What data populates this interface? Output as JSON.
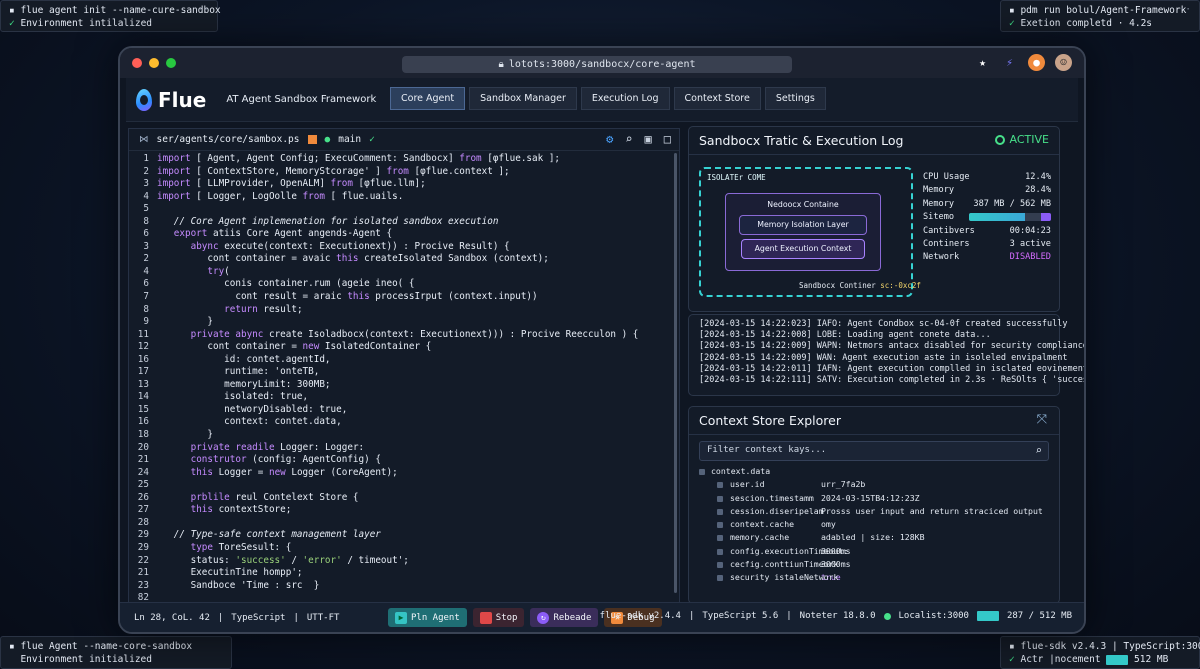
{
  "terminals": {
    "top_left": {
      "line1": "flue agent init --name-cure-sandbox",
      "line2": "Environment intilalized"
    },
    "top_right": {
      "line1": "pdm run bolul/Agent-Framework",
      "line2": "Exetion completd · 4.2s"
    },
    "bottom_left": {
      "line1": "flue Agent  --name-core-sandbox",
      "line2": "Environment initialized"
    },
    "bottom_right": {
      "line1": "flue-sdk v2.4.3 | TypeScript:3000",
      "line2": "Actr |nocement",
      "mem": "512 MB"
    }
  },
  "browser": {
    "url": "lotots:3000/sandbocx/core-agent"
  },
  "app": {
    "name": "Flue",
    "subtitle": "AT Agent Sandbox Framework",
    "tabs": [
      "Core Agent",
      "Sandbox Manager",
      "Execution Log",
      "Context Store",
      "Settings"
    ],
    "active_tab": "Core Agent"
  },
  "editor": {
    "path": "ser/agents/core/sambox.ps",
    "branch": "main",
    "lines": [
      {
        "n": "1",
        "t": "import [ Agent, Agent Config; ExecuComment: Sandbocx] from [φflue.sak ];"
      },
      {
        "n": "2",
        "t": "import [ ContextStore, MemoryStcorage' ] from [φflue.context ];"
      },
      {
        "n": "3",
        "t": "import [ LLMProvider, OpenALM] from [φflue.llm];"
      },
      {
        "n": "4",
        "t": "import [ Logger, LogOolle from [ flue.uails."
      },
      {
        "n": "5",
        "t": ""
      },
      {
        "n": "8",
        "t": "   // Core Agent inplemenation for isolated sandbox execution"
      },
      {
        "n": "6",
        "t": "   export atiis Core Agent angends-Agent {"
      },
      {
        "n": "3",
        "t": "      abync execute(context: Executionext)) : Procive Result) {"
      },
      {
        "n": "2",
        "t": "         cont container = avaic this createIsolated Sandbox (context);"
      },
      {
        "n": "4",
        "t": "         try("
      },
      {
        "n": "6",
        "t": "            conis container.rum (ageie ineo( {"
      },
      {
        "n": "7",
        "t": "              cont result = araic this processIrput (context.input))"
      },
      {
        "n": "8",
        "t": "            return result;"
      },
      {
        "n": "9",
        "t": "         }"
      },
      {
        "n": "11",
        "t": "      private abync create Isoladbocx(context: Executionext))) : Procive Reecculon ) {"
      },
      {
        "n": "12",
        "t": "         cont container = new IsolatedContainer {"
      },
      {
        "n": "16",
        "t": "            id: contet.agentId,"
      },
      {
        "n": "17",
        "t": "            runtime: 'onteTB,"
      },
      {
        "n": "13",
        "t": "            memoryLimit: 300MB;"
      },
      {
        "n": "14",
        "t": "            isolated: true,"
      },
      {
        "n": "15",
        "t": "            networyDisabled: true,"
      },
      {
        "n": "16",
        "t": "            context: contet.data,"
      },
      {
        "n": "18",
        "t": "         }"
      },
      {
        "n": "20",
        "t": "      private readile Logger: Logger:"
      },
      {
        "n": "21",
        "t": "      construtor (config: AgentConfig) {"
      },
      {
        "n": "24",
        "t": "      this Logger = new Logger (CoreAgent);"
      },
      {
        "n": "25",
        "t": ""
      },
      {
        "n": "26",
        "t": "      prblile reul Contelext Store {"
      },
      {
        "n": "27",
        "t": "      this contextStore;"
      },
      {
        "n": "28",
        "t": ""
      },
      {
        "n": "29",
        "t": "   // Type-safe context management layer"
      },
      {
        "n": "29",
        "t": "      type ToreSesult: {"
      },
      {
        "n": "22",
        "t": "      status: 'success' / 'error' / timeout';"
      },
      {
        "n": "21",
        "t": "      ExecutinTine hompp';"
      },
      {
        "n": "23",
        "t": "      Sandboce 'Time : src  }"
      },
      {
        "n": "82",
        "t": ""
      }
    ]
  },
  "sandbox": {
    "title": "Sandbocx Tratic & Execution Log",
    "status": "ACTIVE",
    "iso_label": "ISOLATEr COME",
    "node_container": "Nedoocx Containe",
    "node_memory": "Memory Isolation Layer",
    "node_context": "Agent Execution Context",
    "container_label": "Sandbocx Continer",
    "container_id": "sc:-0xc2f",
    "stats": {
      "cpu_label": "CPU Usage",
      "cpu_value": "12.4%",
      "mem_label": "Memory",
      "mem_pct": "28.4%",
      "mem2_label": "Memory",
      "mem2_value": "387 MB / 562 MB",
      "sitemo_label": "Sitemo",
      "sitemo_fill": 0.68,
      "cant_label": "Cantibvers",
      "cant_value": "00:04:23",
      "cont_label": "Continers",
      "cont_value": "3 active",
      "net_label": "Network",
      "net_value": "DISABLED"
    },
    "colors": {
      "active": "#47e08a",
      "disabled": "#d56cff",
      "iso_border": "#36d3d3"
    }
  },
  "log": [
    "[2024-03-15 14:22:023] IAFO: Agent Condbox sc-04-0f created successfully",
    "[2024-03-15 14:22:008] LOBE: Loading agent conete data...",
    "[2024-03-15 14:22:009] WAPN: Netmors antacx disabled for security compliance",
    "[2024-03-15 14:22:009] WAN: Agent execution aste in isoleled envipalment",
    "[2024-03-15 14:22:011] IAFN: Agent execution complled in isclated eovinement",
    "[2024-03-15 14:22:111] SATV: Execution completed in 2.3s · ReSOlts { 'success' }"
  ],
  "context": {
    "title": "Context Store Explorer",
    "filter_placeholder": "Filter context kays...",
    "root": "context.data",
    "rows": [
      {
        "k": "user.id",
        "v": "urr_7fa2b"
      },
      {
        "k": "sescion.timestamm",
        "v": "2024-03-15TB4:12:23Z"
      },
      {
        "k": "cession.diseripelam",
        "v": "Prosss user input and return straciced output"
      },
      {
        "k": "context.cache",
        "v": "omy"
      },
      {
        "k": "memory.cache",
        "v": "adabled  |  size: 128KB"
      },
      {
        "k": "config.executionTimeout:",
        "v": "3000ms"
      },
      {
        "k": "cecfig.conttiunTimeork",
        "v": "3000ms"
      },
      {
        "k": "security istaleNetwork",
        "v": "true",
        "pur": true
      }
    ]
  },
  "statusbar": {
    "position": "Ln 28, CoL. 42",
    "lang": "TypeScript",
    "enc": "UTT-FT",
    "run": "Pln Agent",
    "stop": "Stop",
    "rebeade": "Rebeade",
    "debug": "Debug",
    "sdk": "flue-sdk v2.4.4",
    "ts": "TypeScript 5.6",
    "node": "Noteter 18.8.0",
    "local": "Localist:3000",
    "mem": "287 / 512 MB"
  }
}
